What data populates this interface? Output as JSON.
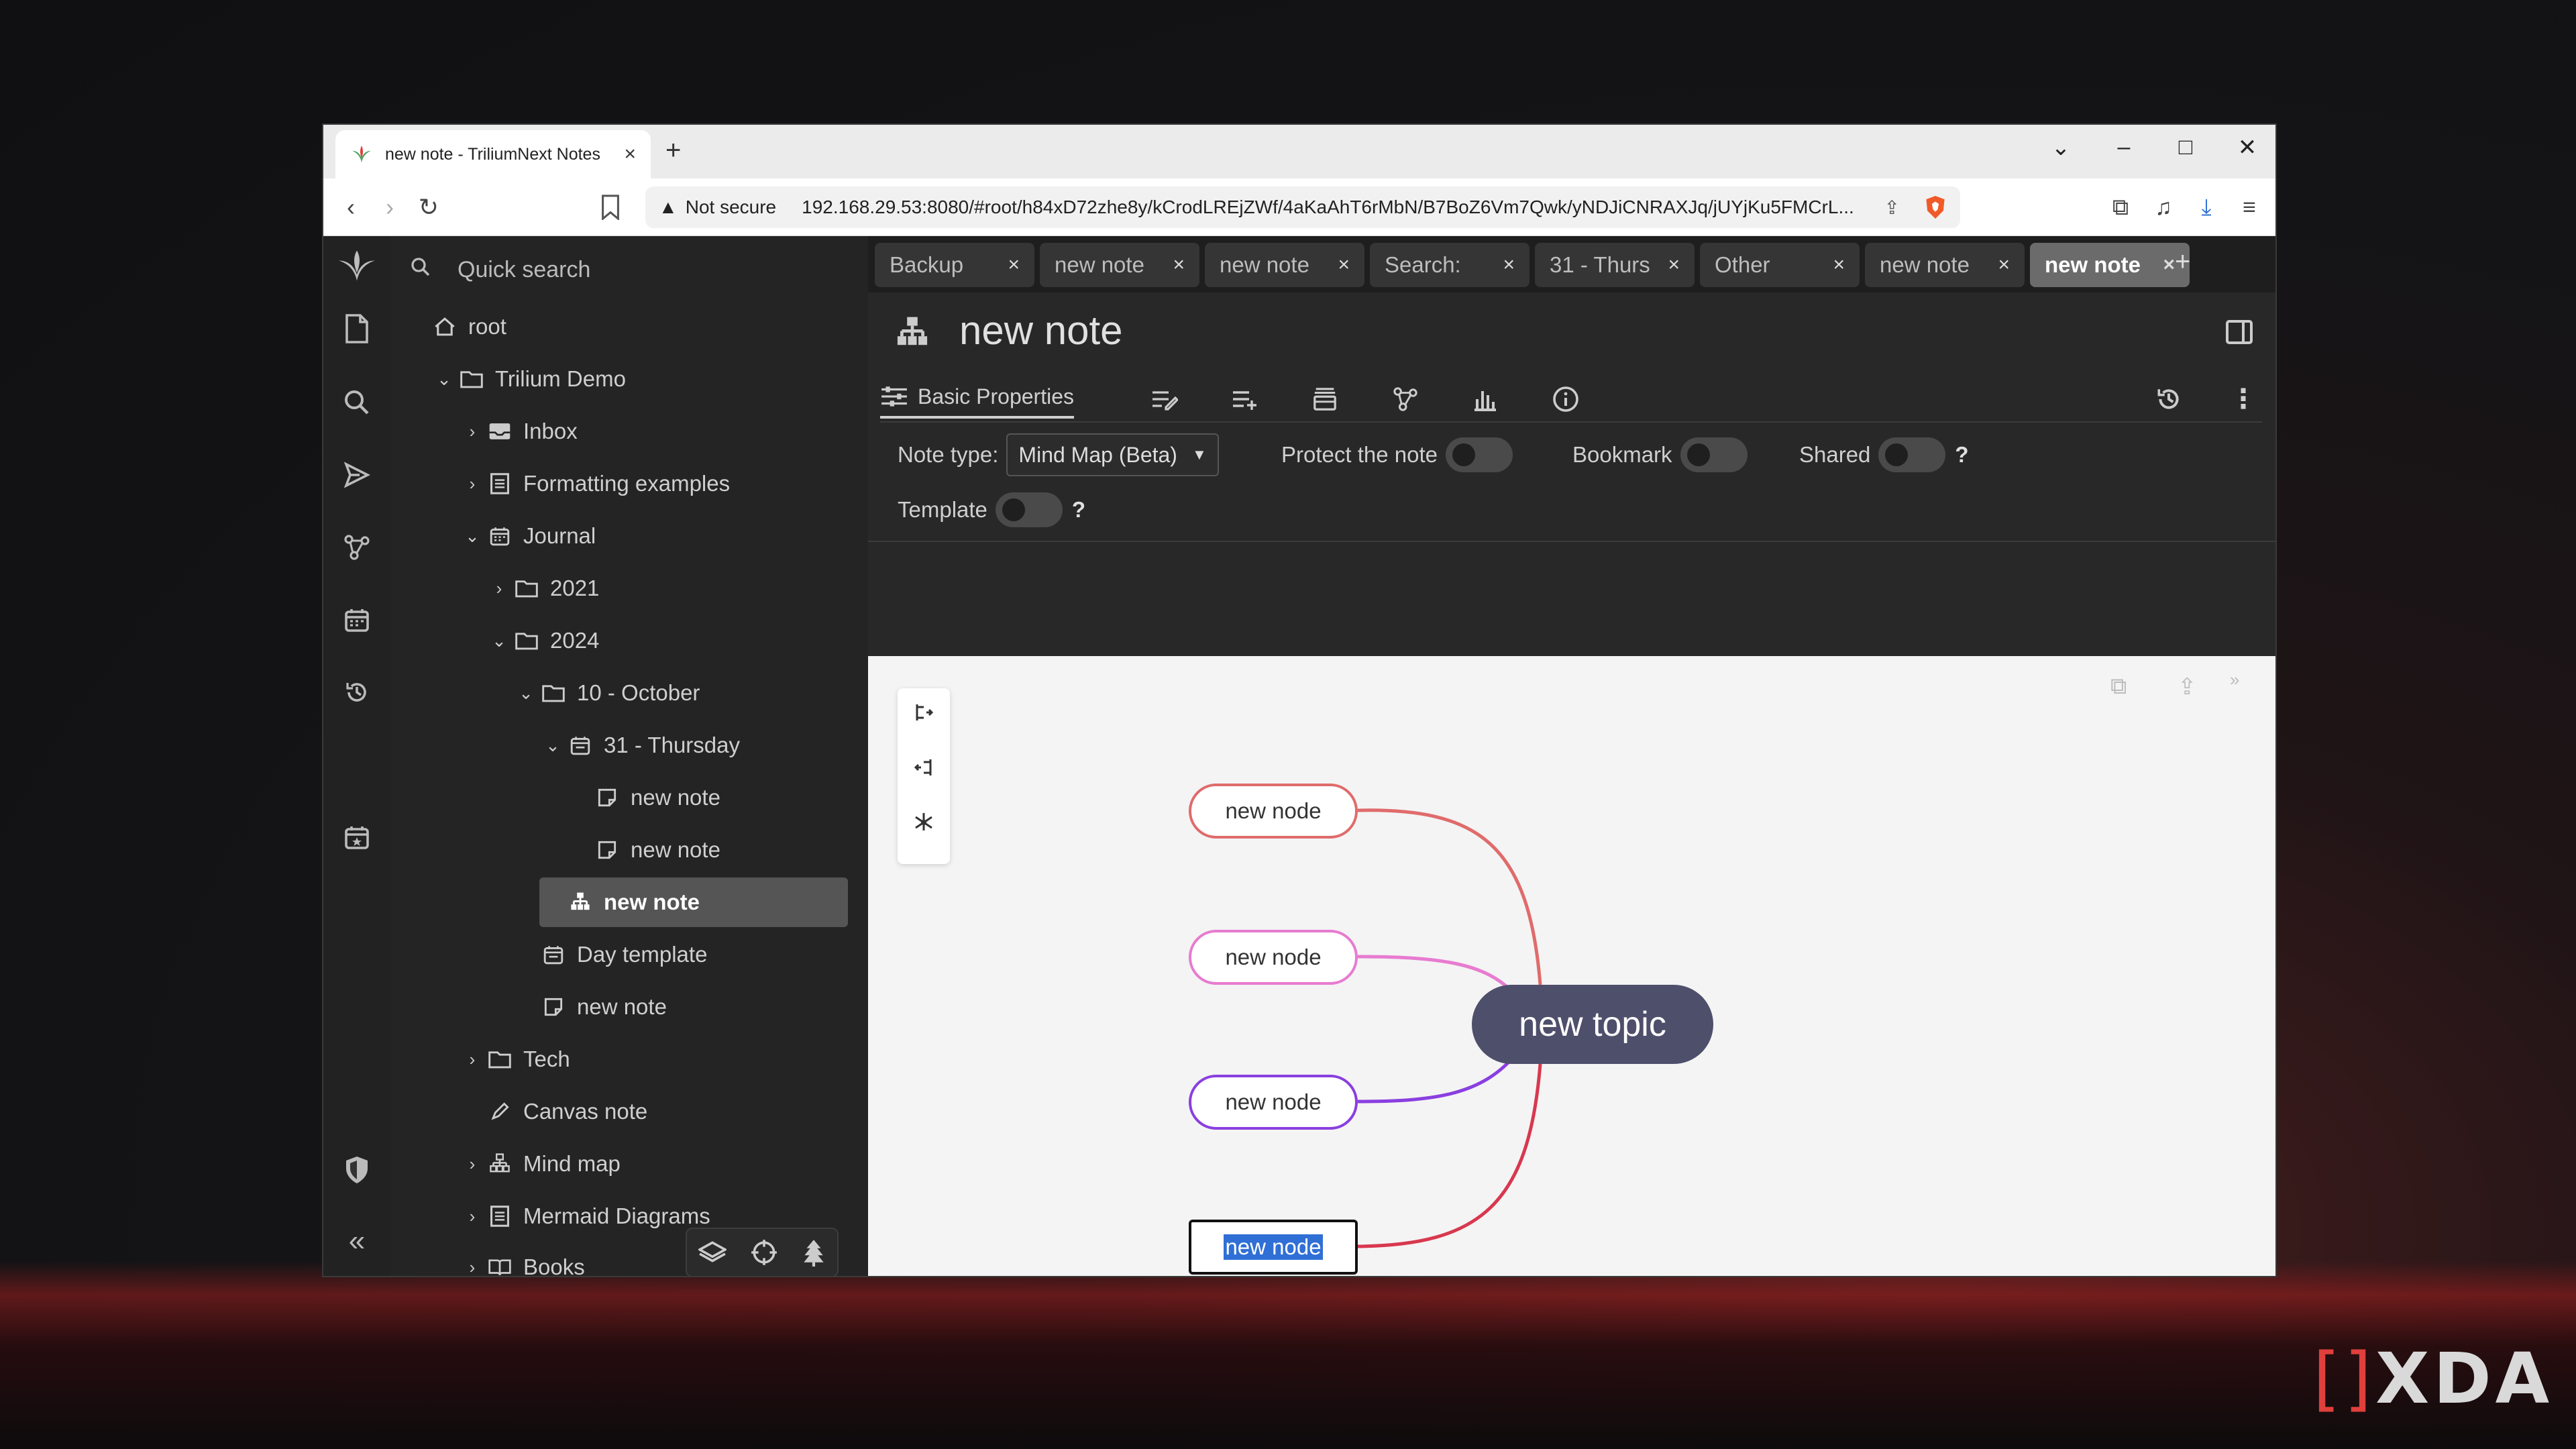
{
  "browser": {
    "tab_title": "new note - TriliumNext Notes",
    "new_tab": "+",
    "not_secure": "Not secure",
    "url": "192.168.29.53:8080/#root/h84xD72zhe8y/kCrodLREjZWf/4aKaAhT6rMbN/B7BoZ6Vm7Qwk/yNDJiCNRAXJq/jUYjKu5FMCrL..."
  },
  "sidebar": {
    "quick_search": "Quick search"
  },
  "tree": {
    "items": [
      {
        "label": "root"
      },
      {
        "label": "Trilium Demo"
      },
      {
        "label": "Inbox"
      },
      {
        "label": "Formatting examples"
      },
      {
        "label": "Journal"
      },
      {
        "label": "2021"
      },
      {
        "label": "2024"
      },
      {
        "label": "10 - October"
      },
      {
        "label": "31 - Thursday"
      },
      {
        "label": "new note"
      },
      {
        "label": "new note"
      },
      {
        "label": "new note"
      },
      {
        "label": "Day template"
      },
      {
        "label": "new note"
      },
      {
        "label": "Tech"
      },
      {
        "label": "Canvas note"
      },
      {
        "label": "Mind map"
      },
      {
        "label": "Mermaid Diagrams"
      },
      {
        "label": "Books"
      }
    ]
  },
  "note_tabs": [
    {
      "label": "Backup"
    },
    {
      "label": "new note"
    },
    {
      "label": "new note"
    },
    {
      "label": "Search:"
    },
    {
      "label": "31 - Thurs"
    },
    {
      "label": "Other"
    },
    {
      "label": "new note"
    },
    {
      "label": "new note"
    }
  ],
  "note": {
    "title": "new note",
    "ribbon_active": "Basic Properties",
    "props": {
      "note_type_label": "Note type:",
      "note_type_value": "Mind Map (Beta)",
      "protect_label": "Protect the note",
      "bookmark_label": "Bookmark",
      "shared_label": "Shared",
      "template_label": "Template",
      "help": "?"
    }
  },
  "mindmap": {
    "root": "new topic",
    "nodes": [
      "new node",
      "new node",
      "new node",
      "new node"
    ],
    "colors": {
      "branch1": "#e06b6b",
      "branch2": "#e77bd0",
      "branch3": "#8a3fe0",
      "branch4": "#d8384f",
      "root_bg": "#4e4f6b"
    }
  },
  "watermark": "XDA"
}
